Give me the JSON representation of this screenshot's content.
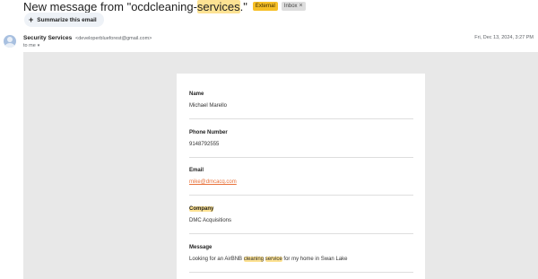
{
  "subject": {
    "prefix": "New message from \"ocdcleaning-",
    "highlight": "services",
    "suffix": ".\""
  },
  "labels": {
    "external": "External",
    "inbox": "Inbox",
    "inbox_close": "×"
  },
  "summarize": {
    "icon": "+",
    "label": "Summarize this email"
  },
  "sender": {
    "name": "Security Services",
    "email": "<developerblueforest@gmail.com>",
    "to": "to me",
    "to_caret": "▾",
    "date": "Fri, Dec 13, 2024, 3:27 PM"
  },
  "form": {
    "name": {
      "label": "Name",
      "value": "Michael Marello"
    },
    "phone": {
      "label": "Phone Number",
      "value": "9148792555"
    },
    "email": {
      "label": "Email",
      "value": "mike@dmcacq.com"
    },
    "company": {
      "label": "Company",
      "value": "DMC Acquisitions"
    },
    "message": {
      "label": "Message",
      "prefix": "Looking for an AirBNB ",
      "hl1": "cleaning",
      "space": " ",
      "hl2": "service",
      "suffix": " for my home in Swan Lake"
    }
  },
  "colors": {
    "highlight": "#fde293",
    "external_tag": "#f6bf26",
    "link": "#e8713a",
    "background": "#e8e8e8"
  }
}
